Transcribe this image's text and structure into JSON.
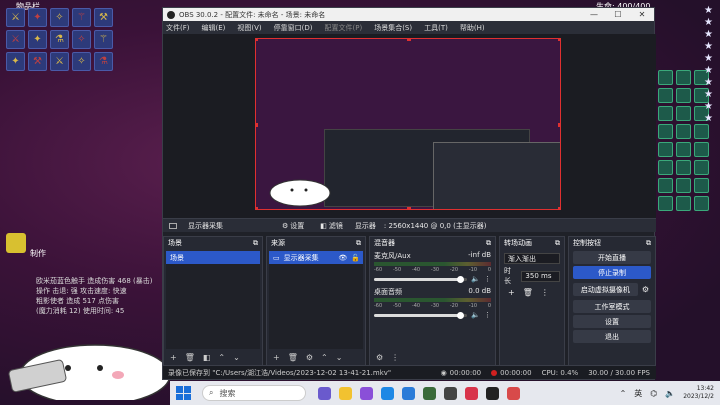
{
  "game": {
    "inventory_label": "物品栏",
    "hud_label": "制作",
    "top_right": "生命: 400/400",
    "chat_lines": [
      "欧米茄蓝色触手 造成伤害 468 (暴击)",
      "操作 击退: 强 攻击速度: 快速",
      "粗影使者 造成 517 点伤害",
      "(魔力消耗 12) 使用时间: 45"
    ]
  },
  "obs": {
    "window_title": "OBS 30.0.2 - 配置文件: 未命名 - 场景: 未命名",
    "menu": [
      {
        "label": "文件(F)",
        "dim": false
      },
      {
        "label": "编辑(E)",
        "dim": false
      },
      {
        "label": "视图(V)",
        "dim": false
      },
      {
        "label": "停靠窗口(D)",
        "dim": false
      },
      {
        "label": "配置文件(P)",
        "dim": true
      },
      {
        "label": "场景集合(S)",
        "dim": false
      },
      {
        "label": "工具(T)",
        "dim": false
      },
      {
        "label": "帮助(H)",
        "dim": false
      }
    ],
    "source_bar": {
      "source_name": "显示器采集",
      "settings_label": "设置",
      "filters_label": "滤镜",
      "display_label": "显示器",
      "display_value": ": 2560x1440 @ 0,0 (主显示器)"
    },
    "scenes": {
      "title": "场景",
      "items": [
        "场景"
      ]
    },
    "sources": {
      "title": "来源",
      "items": [
        "显示器采集"
      ]
    },
    "mixer": {
      "title": "混音器",
      "channels": [
        {
          "name": "麦克风/Aux",
          "level": "-inf dB",
          "volume": 0.92
        },
        {
          "name": "桌面音频",
          "level": "0.0 dB",
          "volume": 0.92
        }
      ],
      "scale": [
        "-60",
        "-55",
        "-50",
        "-45",
        "-40",
        "-35",
        "-30",
        "-25",
        "-20",
        "-15",
        "-10",
        "-5",
        "0"
      ]
    },
    "transitions": {
      "title": "转场动画",
      "type": "渐入渐出",
      "duration_label": "时长",
      "duration_value": "350 ms"
    },
    "controls": {
      "title": "控制按钮",
      "buttons": [
        {
          "label": "开始直播",
          "active": false
        },
        {
          "label": "停止录制",
          "active": true
        },
        {
          "label": "启动虚拟摄像机",
          "active": false
        },
        {
          "label": "工作室模式",
          "active": false
        },
        {
          "label": "设置",
          "active": false
        },
        {
          "label": "退出",
          "active": false
        }
      ]
    },
    "status": {
      "message": "录像已保存到 \"C:/Users/湖江浩/Videos/2023-12-02 13-41-21.mkv\"",
      "live_time": "00:00:00",
      "rec_time": "00:00:00",
      "cpu": "CPU: 0.4%",
      "fps": "30.00 / 30.00 FPS"
    }
  },
  "taskbar": {
    "search_placeholder": "搜索",
    "lang": "英",
    "time": "13:42",
    "date": "2023/12/2"
  },
  "colors": {
    "accent": "#2c59c8",
    "record_red": "#d02020",
    "selection_red": "#e03030"
  }
}
